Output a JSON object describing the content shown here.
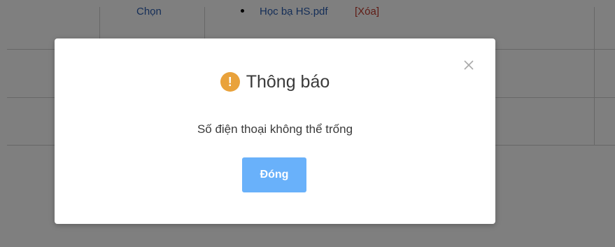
{
  "background_table": {
    "select_link": "Chọn",
    "file_name": "Học bạ HS.pdf",
    "delete_link": "[Xóa]"
  },
  "modal": {
    "title": "Thông báo",
    "warning_glyph": "!",
    "message": "Số điện thoại không thể trống",
    "close_button": "Đóng",
    "close_glyph": "×"
  },
  "colors": {
    "accent": "#69b1fa",
    "warning": "#e9a23b",
    "link": "#2a5db0",
    "delete": "#c0392b"
  }
}
